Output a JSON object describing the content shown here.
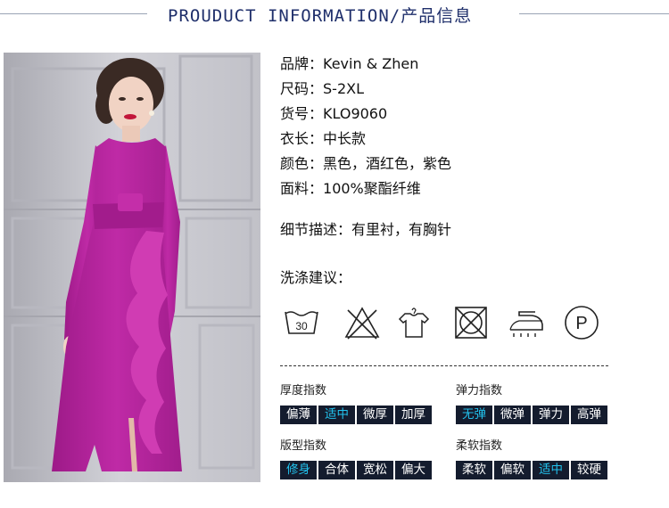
{
  "header": {
    "title": "PROUDUCT INFORMATION/产品信息"
  },
  "product": {
    "rows": [
      {
        "key": "品牌：",
        "value": "Kevin & Zhen"
      },
      {
        "key": "尺码：",
        "value": "S-2XL"
      },
      {
        "key": "货号：",
        "value": "KLO9060"
      },
      {
        "key": "衣长：",
        "value": "中长款"
      },
      {
        "key": "颜色：",
        "value": "黑色，酒红色，紫色"
      },
      {
        "key": "面料：",
        "value": "100%聚酯纤维"
      }
    ],
    "detail_key": "细节描述：",
    "detail_value": "有里衬，有胸针"
  },
  "wash": {
    "title": "洗涤建议：",
    "icons": [
      "wash-30-icon",
      "do-not-bleach-icon",
      "hang-dry-icon",
      "do-not-tumble-dry-icon",
      "iron-low-icon",
      "dry-clean-p-icon"
    ],
    "wash_temperature": "30",
    "dry_clean_letter": "P"
  },
  "scales": [
    {
      "label": "厚度指数",
      "options": [
        "偏薄",
        "适中",
        "微厚",
        "加厚"
      ],
      "selected": 1
    },
    {
      "label": "弹力指数",
      "options": [
        "无弹",
        "微弹",
        "弹力",
        "高弹"
      ],
      "selected": 0
    },
    {
      "label": "版型指数",
      "options": [
        "修身",
        "合体",
        "宽松",
        "偏大"
      ],
      "selected": 0
    },
    {
      "label": "柔软指数",
      "options": [
        "柔软",
        "偏软",
        "适中",
        "较硬"
      ],
      "selected": 2
    }
  ],
  "colors": {
    "title": "#1f2f6b",
    "option_bg": "#141c2e",
    "option_text": "#ffffff",
    "option_selected_text": "#22c1ec",
    "dress": "#b1239a"
  }
}
